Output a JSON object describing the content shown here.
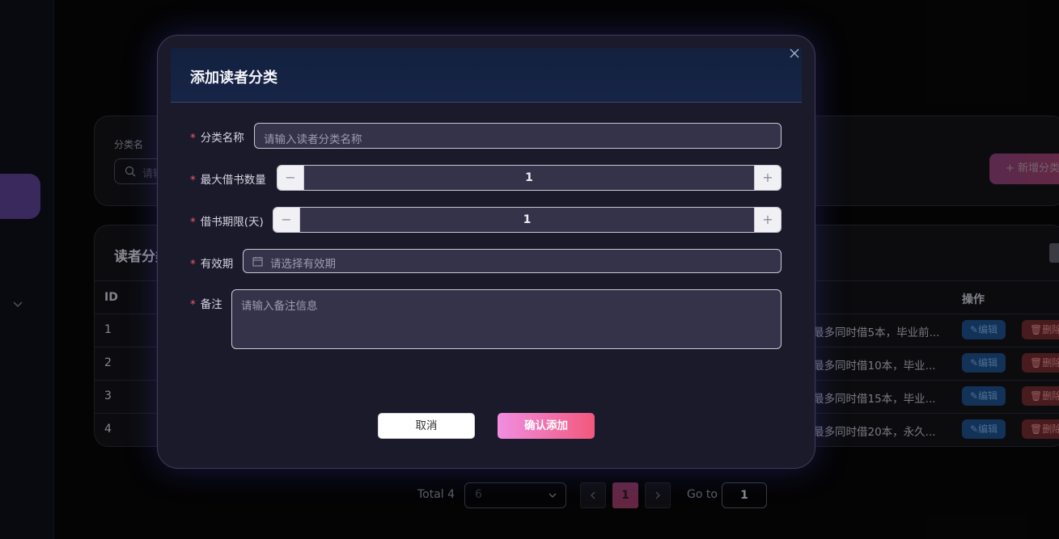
{
  "background": {
    "search": {
      "label": "分类名",
      "placeholder": "请输入"
    },
    "add_button": "+ 新增分类",
    "table": {
      "title": "读者分类",
      "header_id": "ID",
      "header_actions": "操作",
      "rows": [
        {
          "id": "1",
          "remark": "最多同时借5本，毕业前...",
          "edit": "编辑",
          "delete": "删除"
        },
        {
          "id": "2",
          "remark": "最多同时借10本，毕业...",
          "edit": "编辑",
          "delete": "删除"
        },
        {
          "id": "3",
          "remark": "最多同时借15本，毕业...",
          "edit": "编辑",
          "delete": "删除"
        },
        {
          "id": "4",
          "remark": "最多同时借20本，永久...",
          "edit": "编辑",
          "delete": "删除"
        }
      ]
    },
    "pagination": {
      "total": "Total 4",
      "page_size": "6",
      "current_page": "1",
      "goto_label": "Go to",
      "goto_value": "1"
    }
  },
  "modal": {
    "title": "添加读者分类",
    "fields": {
      "name": {
        "label": "分类名称",
        "placeholder": "请输入读者分类名称"
      },
      "max_borrow": {
        "label": "最大借书数量",
        "value": "1"
      },
      "borrow_days": {
        "label": "借书期限(天)",
        "value": "1"
      },
      "validity": {
        "label": "有效期",
        "placeholder": "请选择有效期"
      },
      "remark": {
        "label": "备注",
        "placeholder": "请输入备注信息"
      }
    },
    "required_mark": "*",
    "cancel_label": "取消",
    "confirm_label": "确认添加"
  },
  "colors": {
    "accent_gradient_start": "#f08ee1",
    "accent_gradient_end": "#f2587c",
    "required": "#f25a6b",
    "modal_bg": "#1b1a2b"
  },
  "icons": [
    "close-icon",
    "calendar-icon",
    "search-icon",
    "chevron-down-icon",
    "edit-icon",
    "trash-icon",
    "chevron-left-icon",
    "chevron-right-icon"
  ]
}
